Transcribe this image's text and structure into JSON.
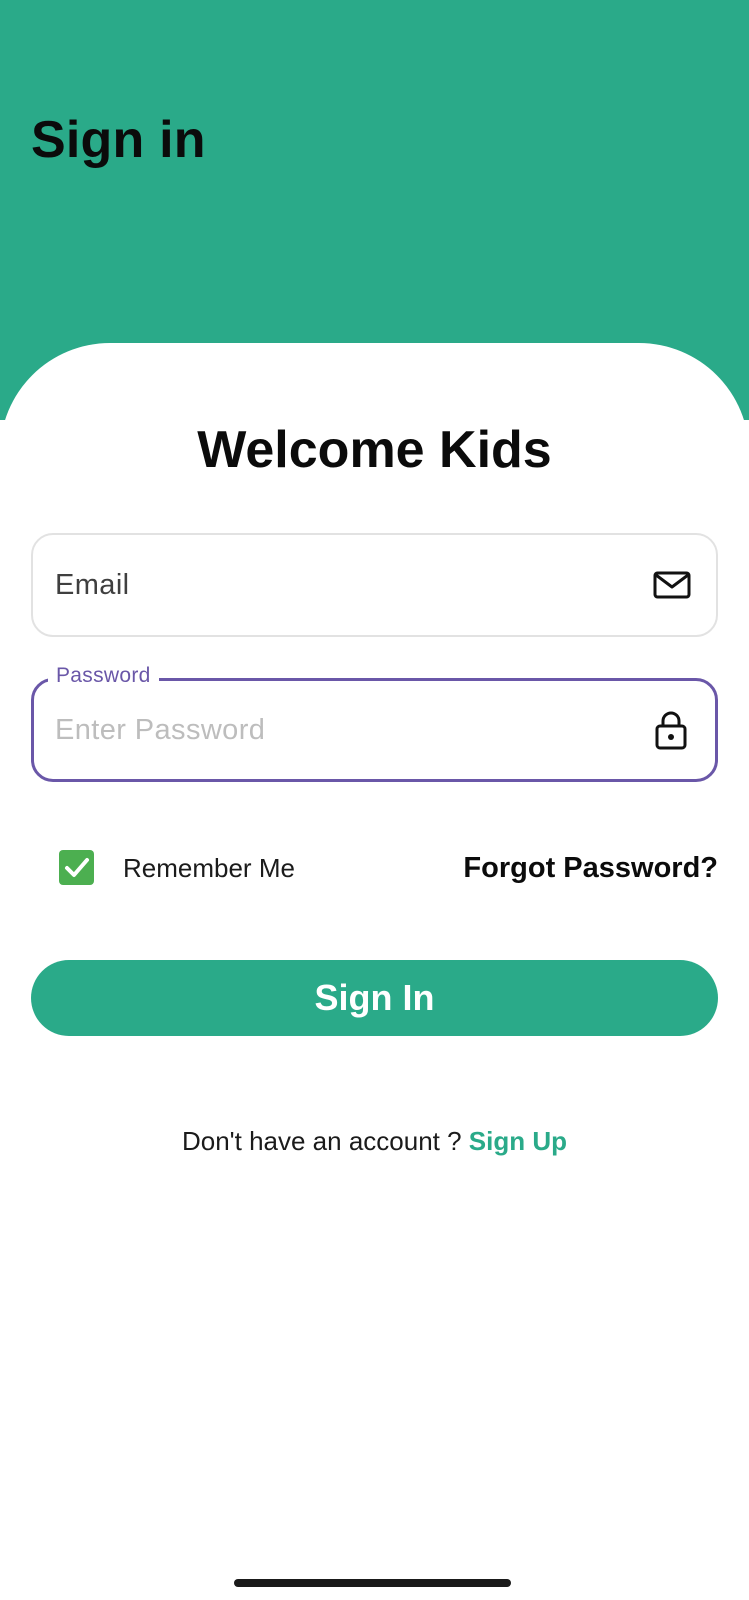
{
  "header": {
    "title": "Sign in",
    "background_color": "#2aaa89"
  },
  "card": {
    "welcome_title": "Welcome Kids"
  },
  "email_field": {
    "value": "Email",
    "icon": "mail-icon"
  },
  "password_field": {
    "label": "Password",
    "placeholder": "Enter Password",
    "icon": "lock-icon",
    "focus_color": "#6a57a8"
  },
  "remember_me": {
    "label": "Remember Me",
    "checked": true,
    "check_color": "#4caf50"
  },
  "forgot_password": {
    "label": "Forgot Password?"
  },
  "sign_in_button": {
    "label": "Sign In",
    "color": "#2aaa89"
  },
  "signup_prompt": {
    "text": "Don't have an account ? ",
    "link_label": "Sign Up"
  }
}
